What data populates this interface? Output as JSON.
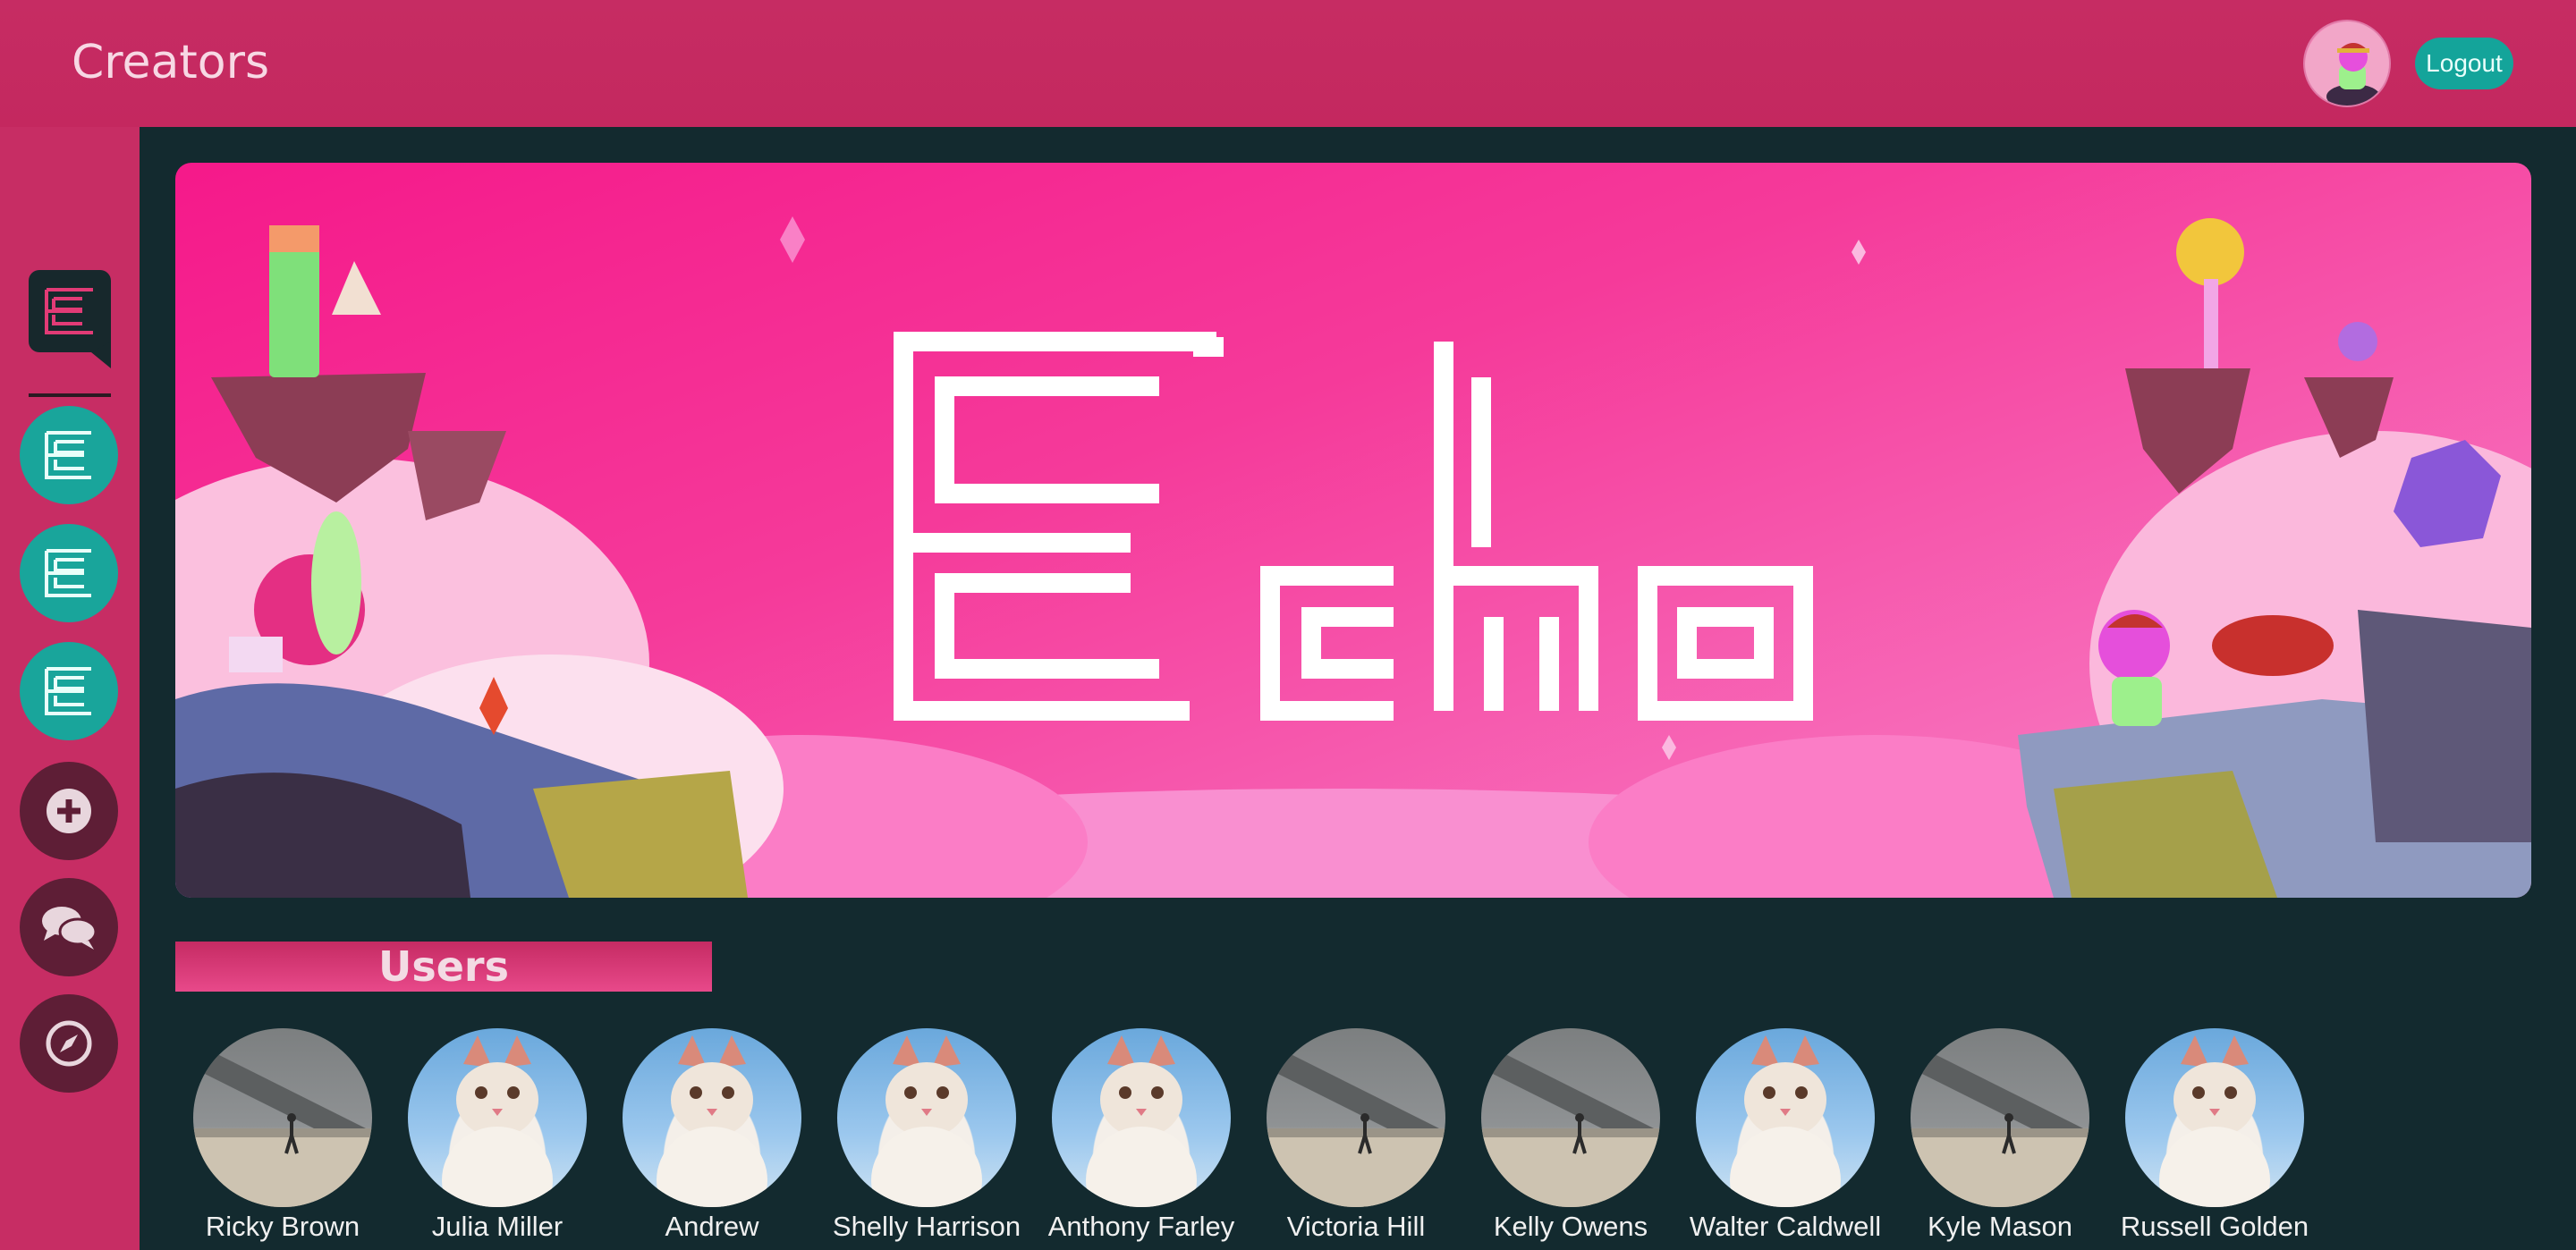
{
  "header": {
    "title": "Creators",
    "logout_label": "Logout"
  },
  "sidebar": {
    "logo_icon": "echo-logo-icon",
    "servers": [
      {
        "icon": "echo-server-icon"
      },
      {
        "icon": "echo-server-icon"
      },
      {
        "icon": "echo-server-icon"
      }
    ],
    "actions": [
      {
        "icon": "plus-icon"
      },
      {
        "icon": "chat-icon"
      },
      {
        "icon": "compass-icon"
      }
    ]
  },
  "banner": {
    "wordmark": "Echo"
  },
  "users_section": {
    "title": "Users"
  },
  "users": [
    {
      "name": "Ricky Brown",
      "photo": "street"
    },
    {
      "name": "Julia Miller",
      "photo": "cat"
    },
    {
      "name": "Andrew",
      "photo": "cat"
    },
    {
      "name": "Shelly Harrison",
      "photo": "cat"
    },
    {
      "name": "Anthony Farley",
      "photo": "cat"
    },
    {
      "name": "Victoria Hill",
      "photo": "street"
    },
    {
      "name": "Kelly Owens",
      "photo": "street"
    },
    {
      "name": "Walter Caldwell",
      "photo": "cat"
    },
    {
      "name": "Kyle Mason",
      "photo": "street"
    },
    {
      "name": "Russell Golden",
      "photo": "cat"
    }
  ],
  "colors": {
    "brand": "#c72d64",
    "accent": "#19a59b",
    "background": "#132a2f"
  }
}
